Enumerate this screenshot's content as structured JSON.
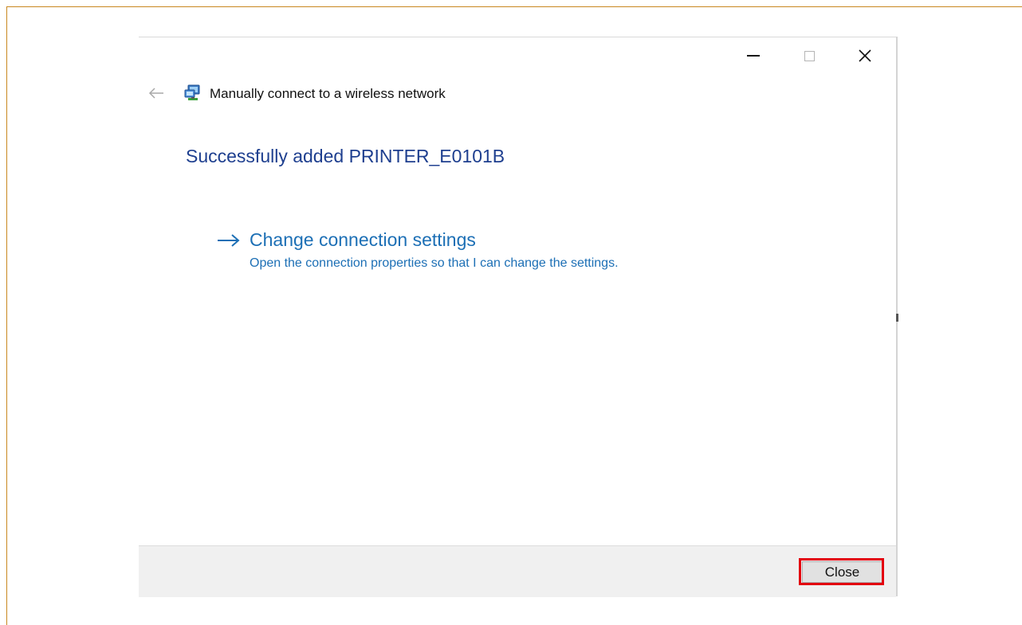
{
  "window": {
    "title": "Manually connect to a wireless network",
    "controls": {
      "minimize_icon": "minimize-icon",
      "maximize_icon": "maximize-icon",
      "close_icon": "close-icon"
    },
    "back_icon": "back-arrow-icon",
    "app_icon": "network-connection-icon"
  },
  "main": {
    "heading": "Successfully added PRINTER_E0101B",
    "option": {
      "icon": "arrow-right-icon",
      "title": "Change connection settings",
      "description": "Open the connection properties so that I can change the settings."
    }
  },
  "footer": {
    "close_label": "Close",
    "highlight_color": "#e3000f"
  },
  "colors": {
    "frame_border": "#c8871f",
    "heading": "#1e3f8f",
    "link": "#1c6fb5"
  }
}
